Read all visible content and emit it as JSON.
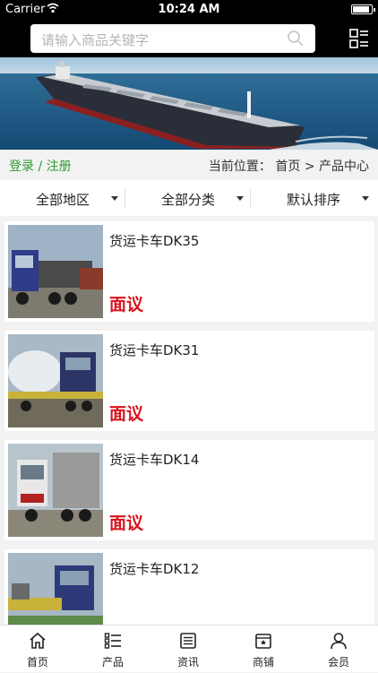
{
  "status": {
    "carrier": "Carrier",
    "time": "10:24 AM"
  },
  "search": {
    "placeholder": "请输入商品关键字"
  },
  "breadcrumb": {
    "login": "登录",
    "separator": "/",
    "register": "注册",
    "location_prefix": "当前位置：",
    "home": "首页",
    "arrow": ">",
    "current": "产品中心"
  },
  "filters": [
    "全部地区",
    "全部分类",
    "默认排序"
  ],
  "products": [
    {
      "title": "货运卡车DK35",
      "price": "面议"
    },
    {
      "title": "货运卡车DK31",
      "price": "面议"
    },
    {
      "title": "货运卡车DK14",
      "price": "面议"
    },
    {
      "title": "货运卡车DK12",
      "price": ""
    }
  ],
  "tabs": [
    {
      "label": "首页",
      "icon": "home-icon"
    },
    {
      "label": "产品",
      "icon": "list-icon"
    },
    {
      "label": "资讯",
      "icon": "news-icon"
    },
    {
      "label": "商铺",
      "icon": "shop-icon"
    },
    {
      "label": "会员",
      "icon": "user-icon"
    }
  ],
  "colors": {
    "accent_green": "#2e9b2e",
    "price_red": "#d9121b",
    "header_bg": "#000000"
  }
}
